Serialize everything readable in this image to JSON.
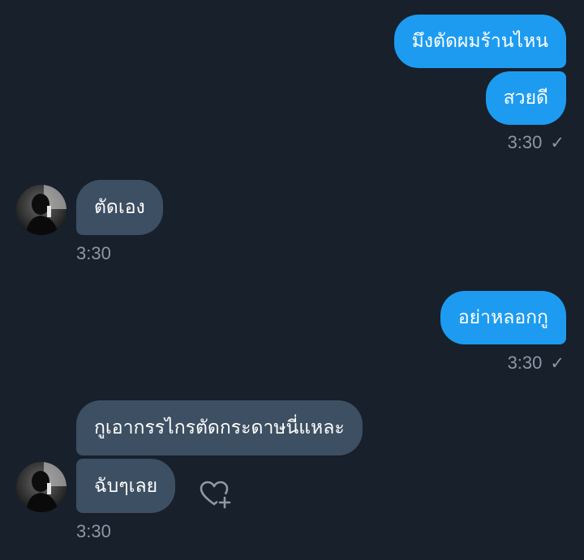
{
  "conversation": {
    "messages": [
      {
        "text": "มึงตัดผมร้านไหน"
      },
      {
        "text": "สวยดี"
      },
      {
        "text": "ตัดเอง"
      },
      {
        "text": "อย่าหลอกกู"
      },
      {
        "text": "กูเอากรรไกรตัดกระดาษนี่แหละ"
      },
      {
        "text": "ฉับๆเลย"
      }
    ],
    "timestamps": [
      "3:30",
      "3:30",
      "3:30",
      "3:30"
    ],
    "read_mark": "✓"
  },
  "colors": {
    "background": "#17202b",
    "outgoing_bubble": "#1d9bf0",
    "incoming_bubble": "#3d4f62",
    "meta_text": "#8b98a5"
  },
  "icons": {
    "avatar": "user-avatar",
    "reaction": "heart-plus-icon"
  }
}
